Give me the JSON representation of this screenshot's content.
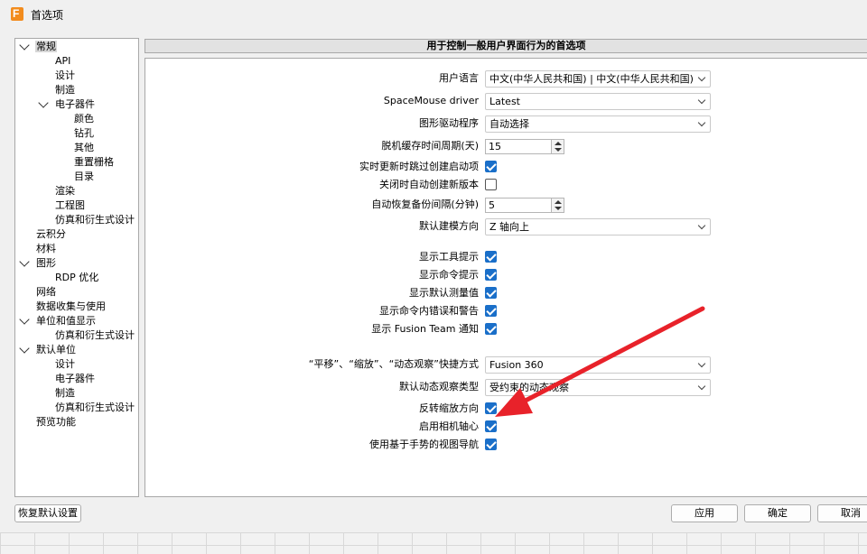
{
  "window": {
    "title": "首选项"
  },
  "tree": {
    "items": [
      {
        "label": "常规",
        "level": 0,
        "expanded": true,
        "selected": true
      },
      {
        "label": "API",
        "level": 1
      },
      {
        "label": "设计",
        "level": 1
      },
      {
        "label": "制造",
        "level": 1
      },
      {
        "label": "电子器件",
        "level": 1,
        "expanded": true
      },
      {
        "label": "颜色",
        "level": 2
      },
      {
        "label": "钻孔",
        "level": 2
      },
      {
        "label": "其他",
        "level": 2
      },
      {
        "label": "重置栅格",
        "level": 2
      },
      {
        "label": "目录",
        "level": 2
      },
      {
        "label": "渲染",
        "level": 1
      },
      {
        "label": "工程图",
        "level": 1
      },
      {
        "label": "仿真和衍生式设计",
        "level": 1
      },
      {
        "label": "云积分",
        "level": 0
      },
      {
        "label": "材料",
        "level": 0
      },
      {
        "label": "图形",
        "level": 0,
        "expanded": true
      },
      {
        "label": "RDP 优化",
        "level": 1
      },
      {
        "label": "网络",
        "level": 0
      },
      {
        "label": "数据收集与使用",
        "level": 0
      },
      {
        "label": "单位和值显示",
        "level": 0,
        "expanded": true
      },
      {
        "label": "仿真和衍生式设计",
        "level": 1
      },
      {
        "label": "默认单位",
        "level": 0,
        "expanded": true
      },
      {
        "label": "设计",
        "level": 1
      },
      {
        "label": "电子器件",
        "level": 1
      },
      {
        "label": "制造",
        "level": 1
      },
      {
        "label": "仿真和衍生式设计",
        "level": 1
      },
      {
        "label": "预览功能",
        "level": 0
      }
    ]
  },
  "panel": {
    "header": "用于控制一般用户界面行为的首选项",
    "rows": [
      {
        "label": "用户语言",
        "type": "select",
        "value": "中文(中华人民共和国) | 中文(中华人民共和国)"
      },
      {
        "label": "SpaceMouse driver",
        "type": "select",
        "value": "Latest"
      },
      {
        "label": "图形驱动程序",
        "type": "select",
        "value": "自动选择"
      },
      {
        "label": "脱机缓存时间周期(天)",
        "type": "spin",
        "value": "15"
      },
      {
        "label": "实时更新时跳过创建启动项",
        "type": "checkbox",
        "checked": true
      },
      {
        "label": "关闭时自动创建新版本",
        "type": "checkbox",
        "checked": false
      },
      {
        "label": "自动恢复备份间隔(分钟)",
        "type": "spin",
        "value": "5"
      },
      {
        "label": "默认建模方向",
        "type": "select",
        "value": "Z 轴向上"
      },
      {
        "label": "显示工具提示",
        "type": "checkbox",
        "checked": true
      },
      {
        "label": "显示命令提示",
        "type": "checkbox",
        "checked": true
      },
      {
        "label": "显示默认测量值",
        "type": "checkbox",
        "checked": true
      },
      {
        "label": "显示命令内错误和警告",
        "type": "checkbox",
        "checked": true
      },
      {
        "label": "显示 Fusion Team 通知",
        "type": "checkbox",
        "checked": true
      },
      {
        "label": "“平移”、“缩放”、“动态观察”快捷方式",
        "type": "select",
        "value": "Fusion 360"
      },
      {
        "label": "默认动态观察类型",
        "type": "select",
        "value": "受约束的动态观察"
      },
      {
        "label": "反转缩放方向",
        "type": "checkbox",
        "checked": true
      },
      {
        "label": "启用相机轴心",
        "type": "checkbox",
        "checked": true
      },
      {
        "label": "使用基于手势的视图导航",
        "type": "checkbox",
        "checked": true
      }
    ]
  },
  "buttons": {
    "reset": "恢复默认设置",
    "apply": "应用",
    "ok": "确定",
    "cancel": "取消"
  },
  "colors": {
    "accent": "#1a6fc9",
    "annotation_arrow": "#e8222a",
    "app_icon": "#f28c1e"
  }
}
